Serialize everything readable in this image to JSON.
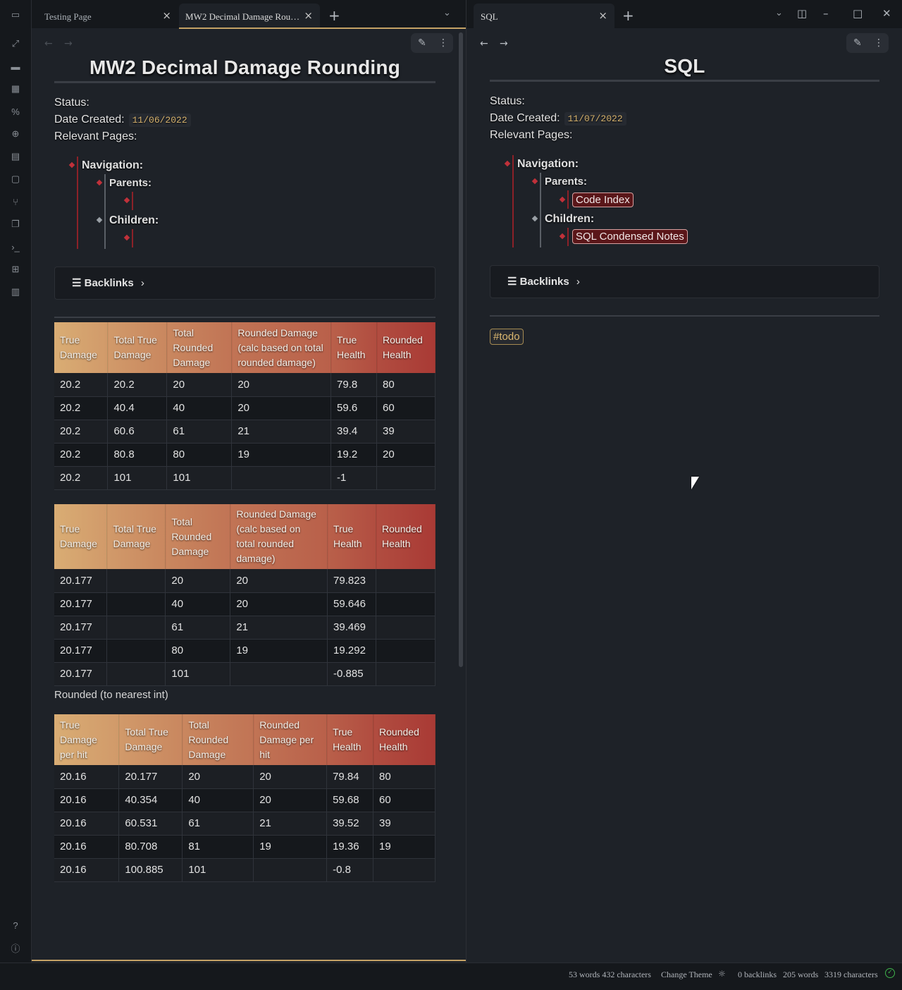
{
  "tabs_left": [
    {
      "label": "Testing Page",
      "active": false
    },
    {
      "label": "MW2 Decimal Damage Rou…",
      "active": true
    }
  ],
  "tabs_right": [
    {
      "label": "SQL",
      "active": true
    }
  ],
  "icons": {
    "close": "×",
    "plus": "+",
    "chevron_down": "⌄",
    "back": "←",
    "forward": "→",
    "edit": "✎",
    "more": "⋮",
    "list": "☰",
    "chevron_right": "›"
  },
  "left_note": {
    "title": "MW2 Decimal Damage Rounding",
    "status_label": "Status:",
    "date_label": "Date Created:",
    "date_value": "11/06/2022",
    "relevant_label": "Relevant Pages:",
    "nav_label": "Navigation:",
    "parents_label": "Parents:",
    "children_label": "Children:",
    "backlinks_label": "Backlinks",
    "caption": "Rounded (to nearest int)",
    "table1": {
      "headers": [
        "True Damage",
        "Total True Damage",
        "Total Rounded Damage",
        "Rounded Damage (calc based on total rounded damage)",
        "True Health",
        "Rounded Health"
      ],
      "rows": [
        [
          "20.2",
          "20.2",
          "20",
          "20",
          "79.8",
          "80"
        ],
        [
          "20.2",
          "40.4",
          "40",
          "20",
          "59.6",
          "60"
        ],
        [
          "20.2",
          "60.6",
          "61",
          "21",
          "39.4",
          "39"
        ],
        [
          "20.2",
          "80.8",
          "80",
          "19",
          "19.2",
          "20"
        ],
        [
          "20.2",
          "101",
          "101",
          "",
          "-1",
          ""
        ]
      ]
    },
    "table2": {
      "headers": [
        "True Damage",
        "Total True Damage",
        "Total Rounded Damage",
        "Rounded Damage (calc based on total rounded damage)",
        "True Health",
        "Rounded Health"
      ],
      "rows": [
        [
          "20.177",
          "",
          "20",
          "20",
          "79.823",
          ""
        ],
        [
          "20.177",
          "",
          "40",
          "20",
          "59.646",
          ""
        ],
        [
          "20.177",
          "",
          "61",
          "21",
          "39.469",
          ""
        ],
        [
          "20.177",
          "",
          "80",
          "19",
          "19.292",
          ""
        ],
        [
          "20.177",
          "",
          "101",
          "",
          "-0.885",
          ""
        ]
      ]
    },
    "table3": {
      "headers": [
        "True Damage per hit",
        "Total True Damage",
        "Total Rounded Damage",
        "Rounded Damage per hit",
        "True Health",
        "Rounded Health"
      ],
      "rows": [
        [
          "20.16",
          "20.177",
          "20",
          "20",
          "79.84",
          "80"
        ],
        [
          "20.16",
          "40.354",
          "40",
          "20",
          "59.68",
          "60"
        ],
        [
          "20.16",
          "60.531",
          "61",
          "21",
          "39.52",
          "39"
        ],
        [
          "20.16",
          "80.708",
          "81",
          "19",
          "19.36",
          "19"
        ],
        [
          "20.16",
          "100.885",
          "101",
          "",
          "-0.8",
          ""
        ]
      ]
    }
  },
  "right_note": {
    "title": "SQL",
    "status_label": "Status:",
    "date_label": "Date Created:",
    "date_value": "11/07/2022",
    "relevant_label": "Relevant Pages:",
    "nav_label": "Navigation:",
    "parents_label": "Parents:",
    "parent_link": "Code Index",
    "children_label": "Children:",
    "child_link": "SQL Condensed Notes",
    "backlinks_label": "Backlinks",
    "tag": "#todo"
  },
  "statusbar": {
    "left_counts": "53 words 432 characters",
    "change_theme": "Change Theme",
    "backlinks": "0 backlinks",
    "words": "205 words",
    "characters": "3319 characters"
  },
  "colors": {
    "header_gradient_start": "#d9ad74",
    "header_gradient_end": "#a93a35",
    "accent_gold": "#c4a265",
    "link_red": "#c0313a"
  }
}
